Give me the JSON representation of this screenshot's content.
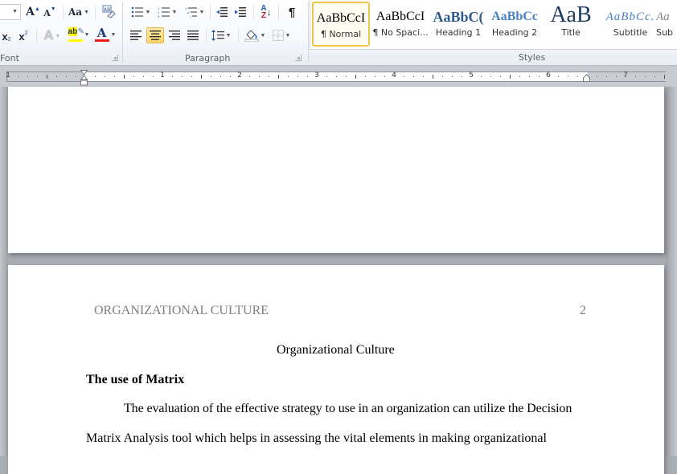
{
  "ribbon": {
    "font_group": {
      "label": "Font",
      "grow_font": "A",
      "shrink_font": "A",
      "change_case": "Aa",
      "subscript": "x",
      "superscript": "x",
      "text_effects": "A",
      "highlight": "ab",
      "font_color": "A",
      "highlight_color": "#ffff00",
      "font_color_value": "#e81c1c"
    },
    "paragraph_group": {
      "label": "Paragraph",
      "sort_glyph": "A↓",
      "pilcrow": "¶",
      "active_alignment": "center"
    },
    "styles_group": {
      "label": "Styles",
      "items": [
        {
          "sample": "AaBbCcI",
          "name": "¶ Normal",
          "selected": true
        },
        {
          "sample": "AaBbCcI",
          "name": "¶ No Spaci...",
          "selected": false
        },
        {
          "sample": "AaBbC(",
          "name": "Heading 1",
          "selected": false
        },
        {
          "sample": "AaBbCc",
          "name": "Heading 2",
          "selected": false
        },
        {
          "sample": "AaB",
          "name": "Title",
          "selected": false
        },
        {
          "sample": "AaBbCc.",
          "name": "Subtitle",
          "selected": false
        },
        {
          "sample": "Aa",
          "name": "Sub",
          "selected": false
        }
      ]
    }
  },
  "ruler": {
    "numbers": [
      "1",
      "1",
      "2",
      "3",
      "4",
      "5",
      "6",
      "7"
    ]
  },
  "document": {
    "page2": {
      "header_left": "ORGANIZATIONAL CULTURE",
      "header_page_number": "2",
      "title": "Organizational Culture",
      "heading": "The use of Matrix",
      "para_line1": "The evaluation of the effective strategy to use in an organization can utilize the Decision",
      "para_line2": "Matrix Analysis tool which helps in assessing the vital elements in making organizational"
    }
  }
}
